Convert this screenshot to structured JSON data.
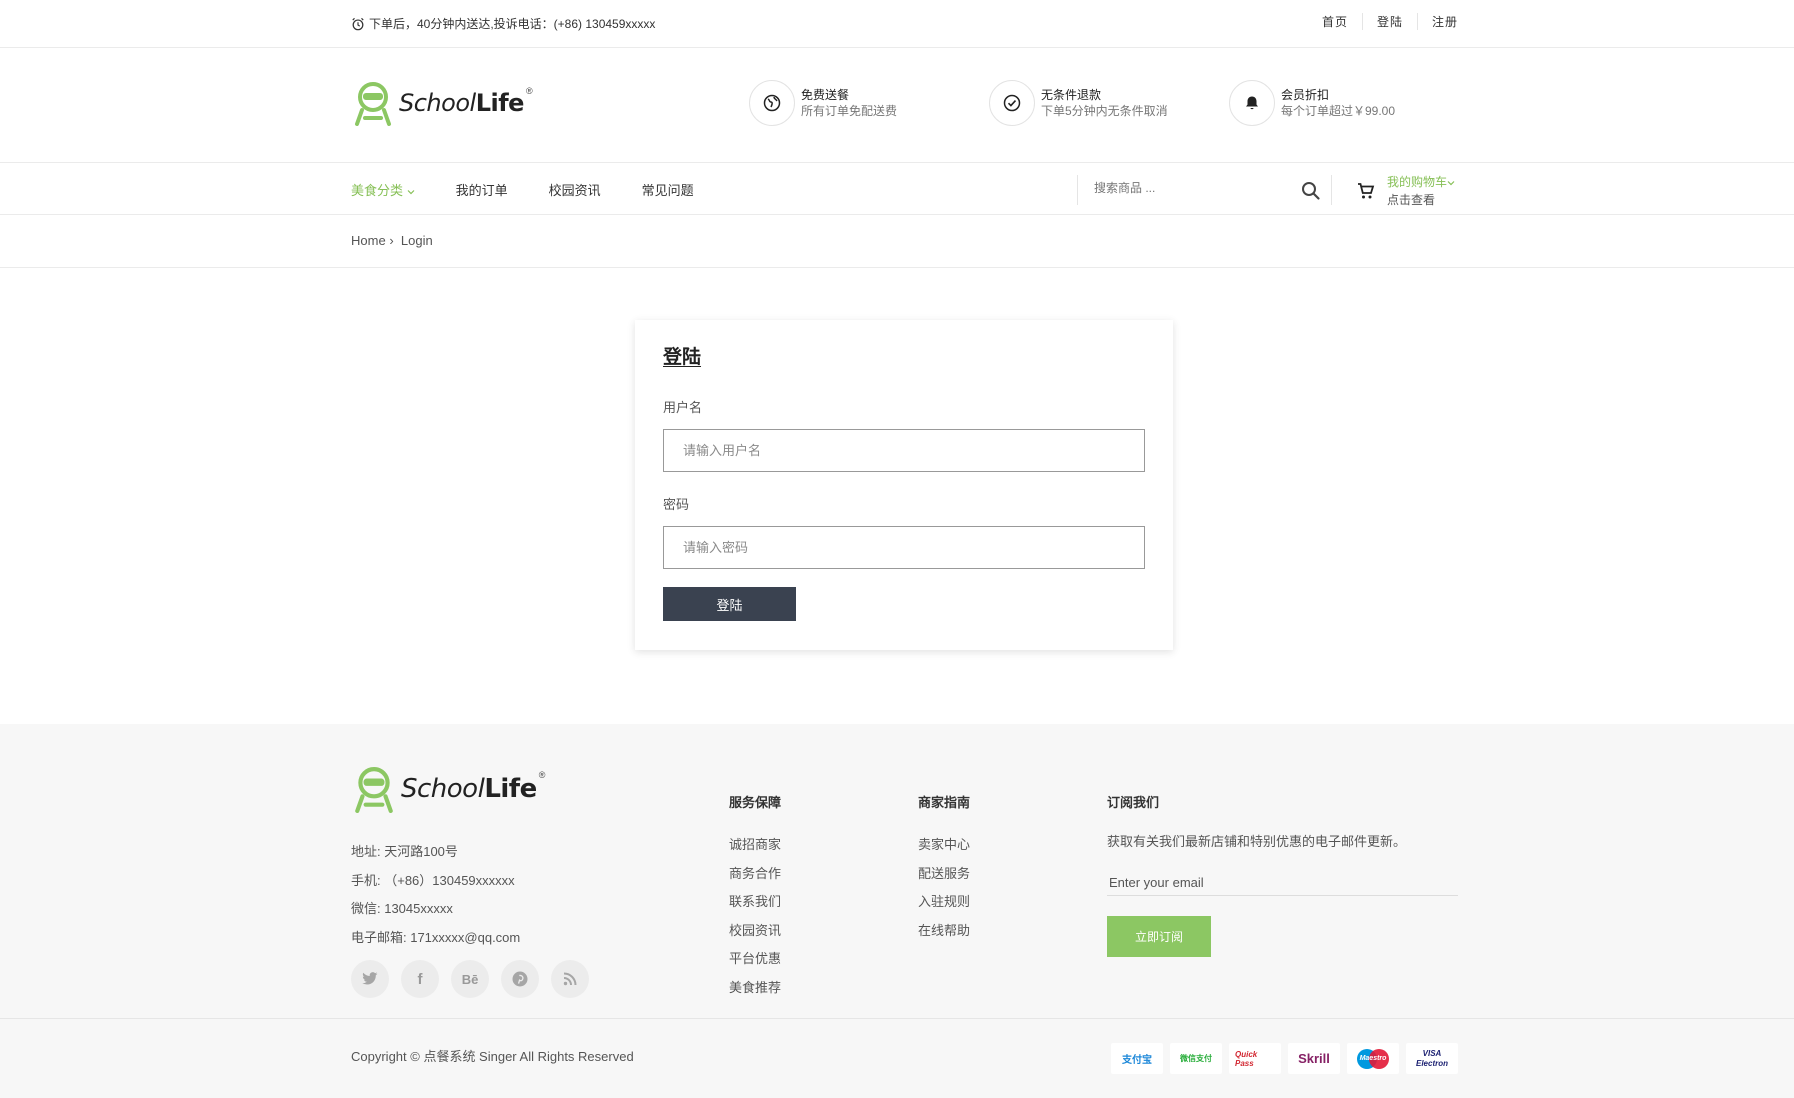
{
  "topbar": {
    "notice": "下单后，40分钟内送达,投诉电话：(+86) 130459xxxxx",
    "links": [
      "首页",
      "登陆",
      "注册"
    ]
  },
  "header": {
    "logo_italic": "School",
    "logo_bold": "Life",
    "logo_reg": "®",
    "features": [
      {
        "title": "免费送餐",
        "desc": "所有订单免配送费",
        "icon": "globe-icon"
      },
      {
        "title": "无条件退款",
        "desc": "下单5分钟内无条件取消",
        "icon": "check-circle-icon"
      },
      {
        "title": "会员折扣",
        "desc": "每个订单超过￥99.00",
        "icon": "bell-icon"
      }
    ]
  },
  "nav": {
    "menu": [
      "美食分类",
      "我的订单",
      "校园资讯",
      "常见问题"
    ],
    "search_placeholder": "搜索商品 ...",
    "cart_title": "我的购物车",
    "cart_sub": "点击查看",
    "accent": "#87c057"
  },
  "breadcrumb": {
    "home": "Home",
    "sep": "›",
    "current": "Login"
  },
  "login": {
    "title": "登陆",
    "username_label": "用户名",
    "username_placeholder": "请输入用户名",
    "password_label": "密码",
    "password_placeholder": "请输入密码",
    "submit": "登陆",
    "button_color": "#3a4250"
  },
  "footer": {
    "contact": [
      "地址: 天河路100号",
      "手机: （+86）130459xxxxxx",
      "微信: 13045xxxxx",
      "电子邮箱: 171xxxxx@qq.com"
    ],
    "social": [
      "twitter-icon",
      "facebook-icon",
      "behance-icon",
      "pinterest-icon",
      "rss-icon"
    ],
    "social_glyphs": [
      "t",
      "f",
      "Bē",
      "p",
      "rss"
    ],
    "col1": {
      "title": "服务保障",
      "items": [
        "诚招商家",
        "商务合作",
        "联系我们",
        "校园资讯",
        "平台优惠",
        "美食推荐"
      ]
    },
    "col2": {
      "title": "商家指南",
      "items": [
        "卖家中心",
        "配送服务",
        "入驻规则",
        "在线帮助"
      ]
    },
    "subscribe": {
      "title": "订阅我们",
      "desc": "获取有关我们最新店铺和特别优惠的电子邮件更新。",
      "placeholder": "Enter your email",
      "button": "立即订阅"
    },
    "copyright": "Copyright © 点餐系统 Singer All Rights Reserved",
    "payments": [
      "支付宝",
      "微信支付",
      "Quick Pass",
      "Skrill",
      "Maestro",
      "VISA Electron"
    ]
  }
}
